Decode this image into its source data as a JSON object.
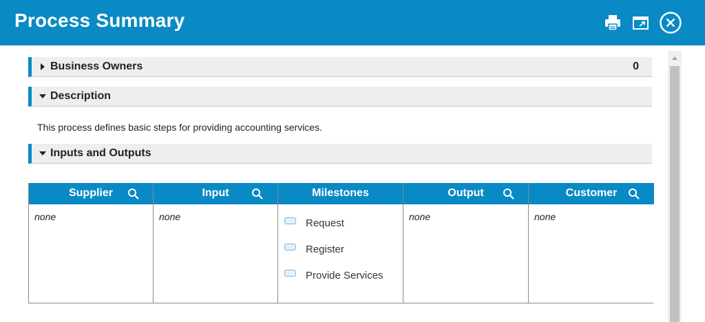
{
  "header": {
    "title": "Process Summary",
    "icons": [
      "print-icon",
      "popout-icon",
      "close-icon"
    ],
    "color": "#0a8ac4"
  },
  "sections": {
    "business_owners": {
      "label": "Business Owners",
      "count": "0",
      "expanded": false
    },
    "description": {
      "label": "Description",
      "expanded": true,
      "text": "This process defines basic steps for providing accounting services."
    },
    "inputs_outputs": {
      "label": "Inputs and Outputs",
      "expanded": true
    }
  },
  "io_table": {
    "columns": [
      {
        "key": "supplier",
        "header": "Supplier",
        "searchable": true,
        "value": "none"
      },
      {
        "key": "input",
        "header": "Input",
        "searchable": true,
        "value": "none"
      },
      {
        "key": "milestones",
        "header": "Milestones",
        "searchable": false
      },
      {
        "key": "output",
        "header": "Output",
        "searchable": true,
        "value": "none"
      },
      {
        "key": "customer",
        "header": "Customer",
        "searchable": true,
        "value": "none"
      }
    ],
    "milestones": [
      "Request",
      "Register",
      "Provide Services"
    ]
  }
}
